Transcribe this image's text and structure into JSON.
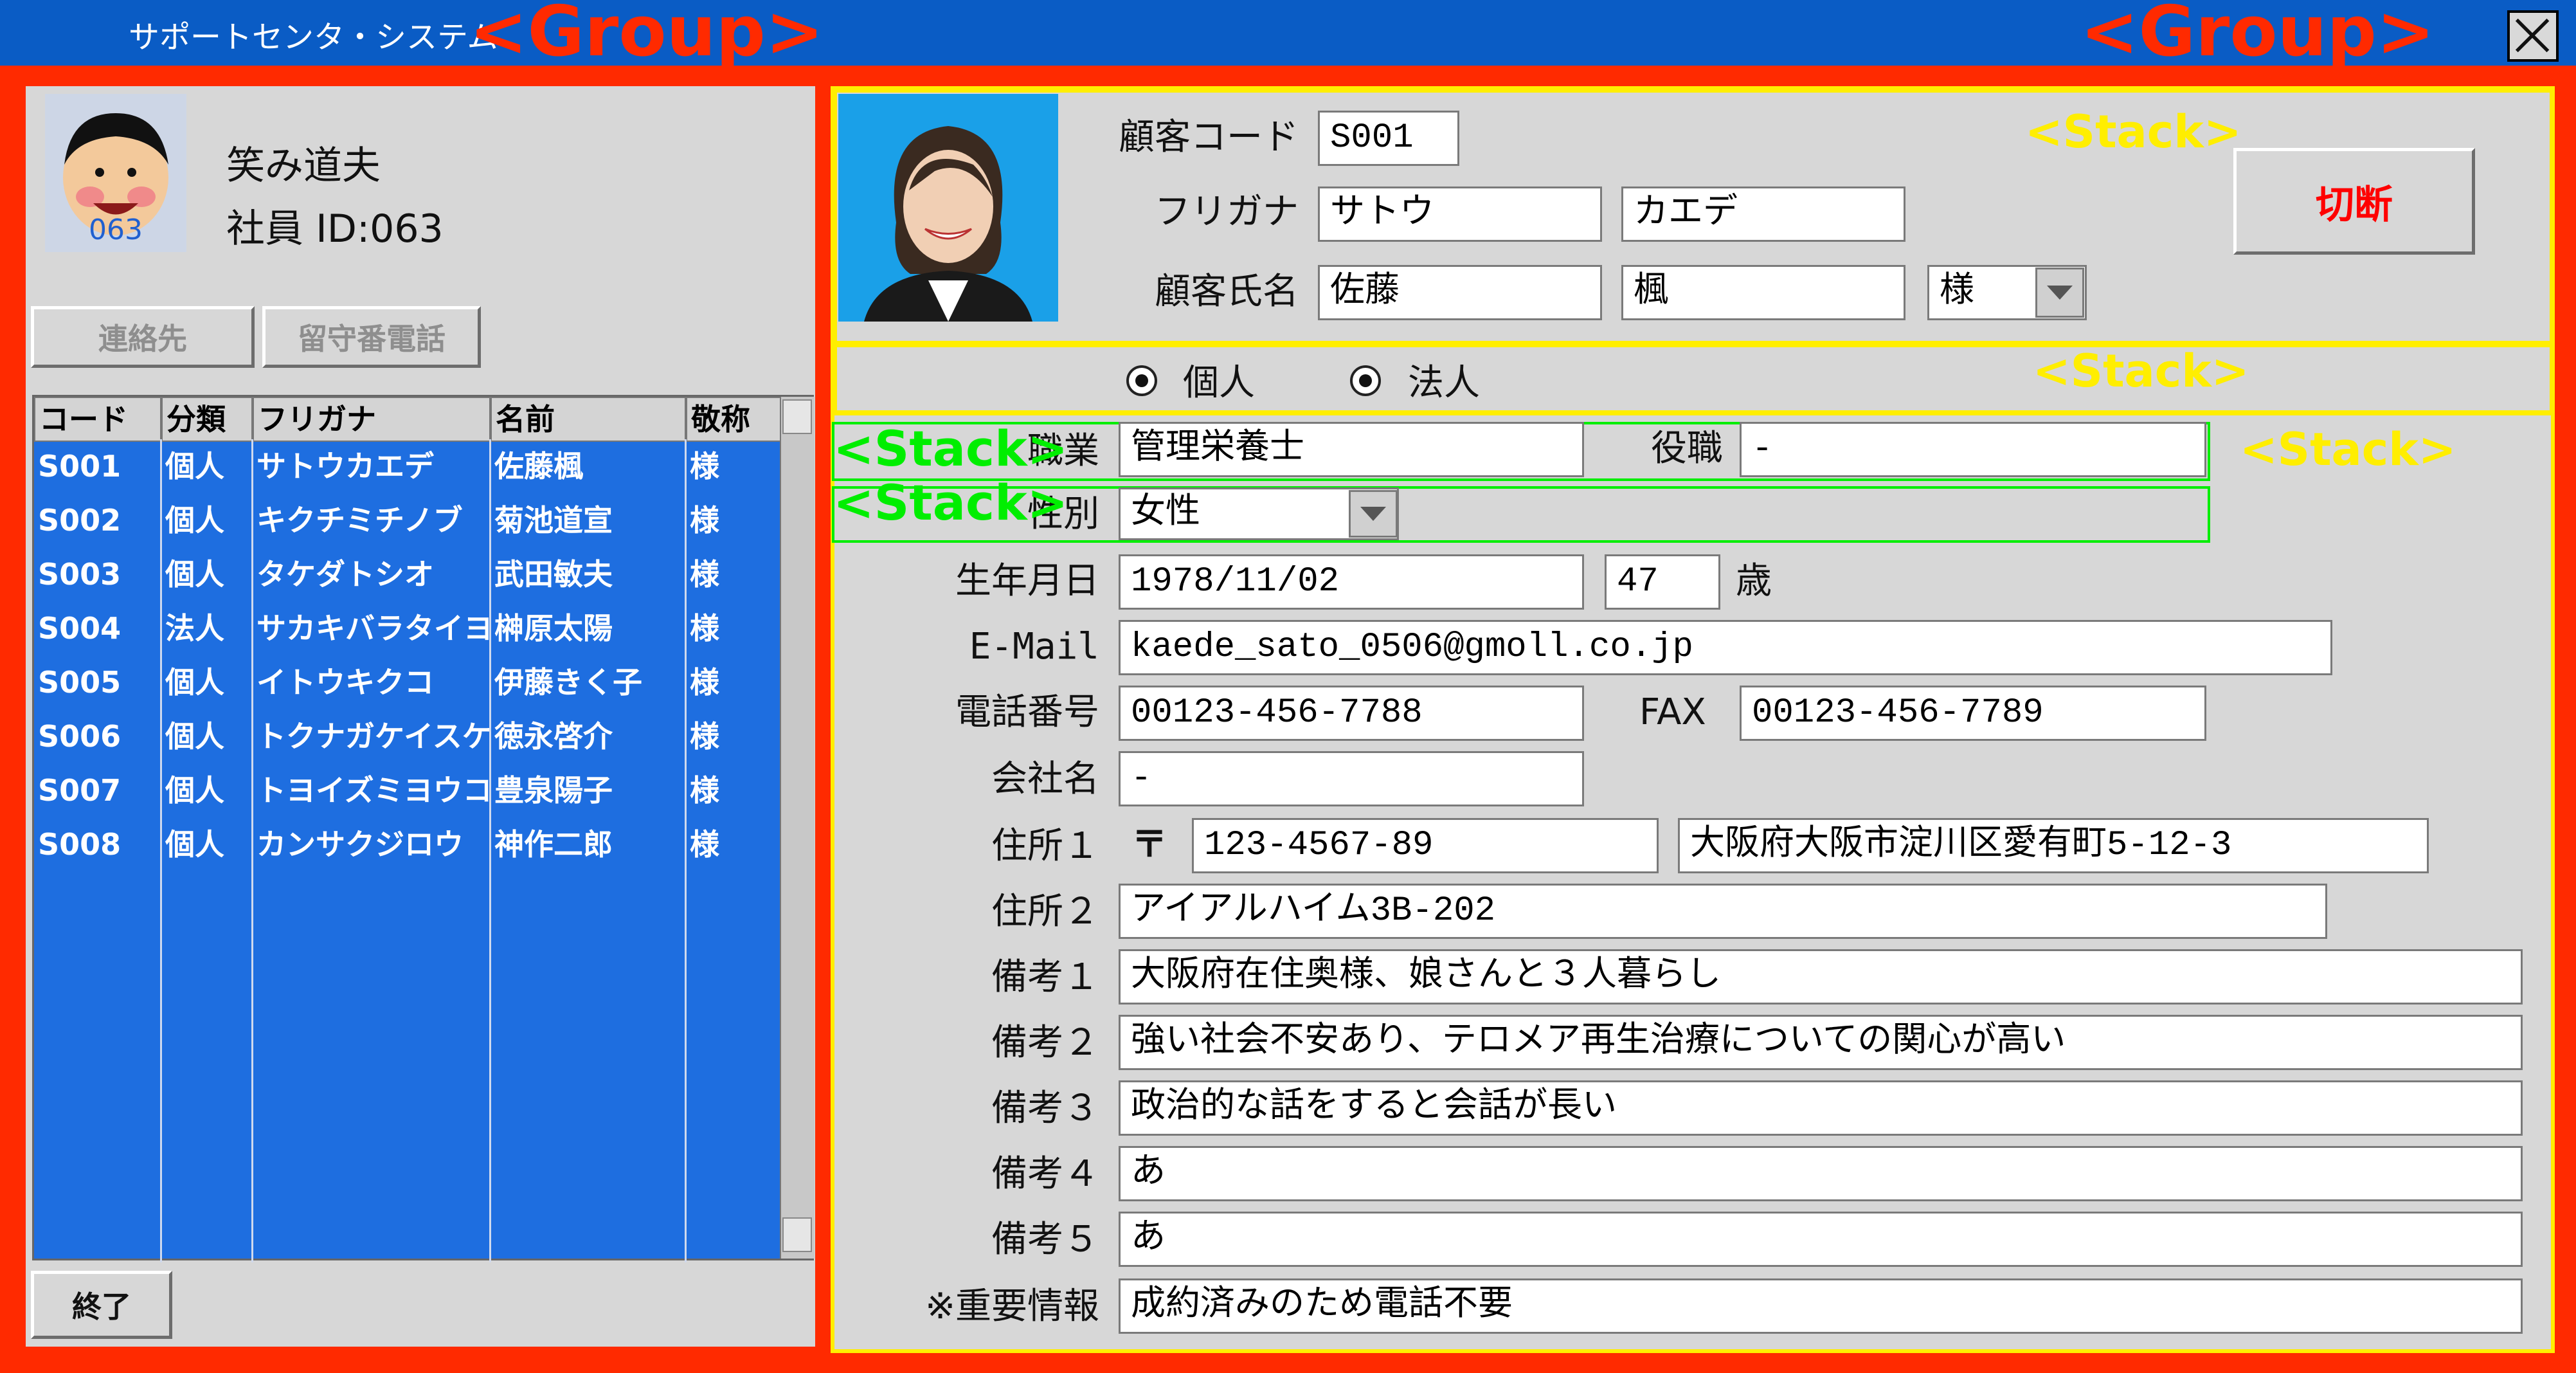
{
  "window": {
    "title": "サポートセンタ・システム"
  },
  "annotations": {
    "group": "<Group>",
    "stack": "<Stack>"
  },
  "operator": {
    "avatar_number": "063",
    "name": "笑み道夫",
    "employee_id": "社員 ID:063"
  },
  "left_buttons": {
    "contacts": "連絡先",
    "voicemail": "留守番電話",
    "exit": "終了"
  },
  "customer_list": {
    "columns": [
      "コード",
      "分類",
      "フリガナ",
      "名前",
      "敬称"
    ],
    "rows": [
      [
        "S001",
        "個人",
        "サトウカエデ",
        "佐藤楓",
        "様"
      ],
      [
        "S002",
        "個人",
        "キクチミチノブ",
        "菊池道宣",
        "様"
      ],
      [
        "S003",
        "個人",
        "タケダトシオ",
        "武田敏夫",
        "様"
      ],
      [
        "S004",
        "法人",
        "サカキバラタイヨ",
        "榊原太陽",
        "様"
      ],
      [
        "S005",
        "個人",
        "イトウキクコ",
        "伊藤きく子",
        "様"
      ],
      [
        "S006",
        "個人",
        "トクナガケイスケ",
        "徳永啓介",
        "様"
      ],
      [
        "S007",
        "個人",
        "トヨイズミヨウコ",
        "豊泉陽子",
        "様"
      ],
      [
        "S008",
        "個人",
        "カンサクジロウ",
        "神作二郎",
        "様"
      ]
    ]
  },
  "customer": {
    "code_label": "顧客コード",
    "code": "S001",
    "kana_label": "フリガナ",
    "kana_last": "サトウ",
    "kana_first": "カエデ",
    "name_label": "顧客氏名",
    "name_last": "佐藤",
    "name_first": "楓",
    "honorific": "様",
    "disconnect": "切断",
    "type_personal": "個人",
    "type_corporate": "法人",
    "occupation_label": "職業",
    "occupation": "管理栄養士",
    "position_label": "役職",
    "position": "-",
    "gender_label": "性別",
    "gender": "女性",
    "birth_label": "生年月日",
    "birth": "1978/11/02",
    "age": "47",
    "age_unit": "歳",
    "email_label": "E-Mail",
    "email": "kaede_sato_0506@gmoll.co.jp",
    "phone_label": "電話番号",
    "phone": "00123-456-7788",
    "fax_label": "FAX",
    "fax": "00123-456-7789",
    "company_label": "会社名",
    "company": "-",
    "address1_label": "住所１",
    "postal_mark": "〒",
    "postal": "123-4567-89",
    "address1": "大阪府大阪市淀川区愛有町5-12-3",
    "address2_label": "住所２",
    "address2": "アイアルハイム3B-202",
    "note1_label": "備考１",
    "note1": "大阪府在住奥様、娘さんと３人暮らし",
    "note2_label": "備考２",
    "note2": "強い社会不安あり、テロメア再生治療についての関心が高い",
    "note3_label": "備考３",
    "note3": "政治的な話をすると会話が長い",
    "note4_label": "備考４",
    "note4": "あ",
    "note5_label": "備考５",
    "note5": "あ",
    "important_label": "※重要情報",
    "important": "成約済みのため電話不要"
  },
  "colors": {
    "titlebar": "#0a5cc5",
    "frame": "#ff2a00",
    "list_bg": "#1e6ee0",
    "stack_yellow": "#ffee00",
    "stack_green": "#00ee00",
    "disconnect_text": "#ff0000"
  }
}
